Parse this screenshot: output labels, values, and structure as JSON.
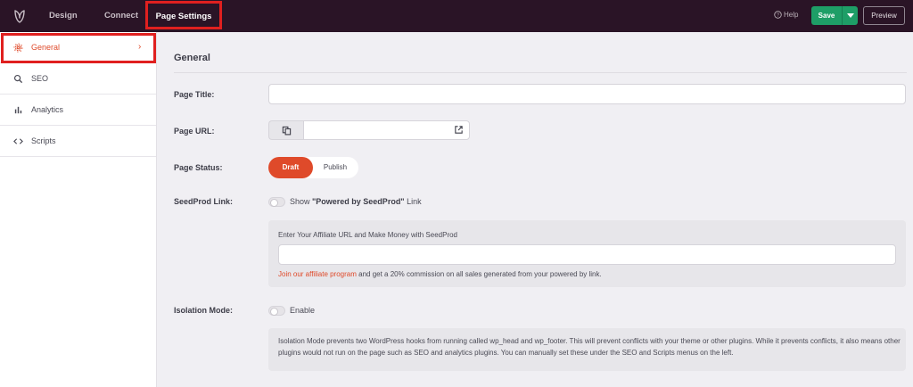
{
  "topbar": {
    "tabs": {
      "design": "Design",
      "connect": "Connect",
      "page_settings": "Page Settings"
    },
    "help": "Help",
    "save": "Save",
    "preview": "Preview"
  },
  "sidebar": {
    "items": [
      {
        "label": "General",
        "icon": "gear-icon"
      },
      {
        "label": "SEO",
        "icon": "search-icon"
      },
      {
        "label": "Analytics",
        "icon": "bar-chart-icon"
      },
      {
        "label": "Scripts",
        "icon": "code-icon"
      }
    ]
  },
  "main": {
    "heading": "General",
    "page_title_label": "Page Title:",
    "page_title_value": "",
    "page_url_label": "Page URL:",
    "page_url_value": "",
    "page_status_label": "Page Status:",
    "status_draft": "Draft",
    "status_publish": "Publish",
    "seedprod_link_label": "SeedProd Link:",
    "seedprod_show": "Show ",
    "seedprod_powered": "\"Powered by SeedProd\"",
    "seedprod_link_word": " Link",
    "affiliate_title": "Enter Your Affiliate URL and Make Money with SeedProd",
    "affiliate_value": "",
    "affiliate_link": "Join our affiliate program",
    "affiliate_note": " and get a 20% commission on all sales generated from your powered by link.",
    "isolation_label": "Isolation Mode:",
    "isolation_enable": "Enable",
    "isolation_text": "Isolation Mode prevents two WordPress hooks from running called wp_head and wp_footer. This will prevent conflicts with your theme or other plugins. While it prevents conflicts, it also means other plugins would not run on the page such as SEO and analytics plugins. You can manually set these under the SEO and Scripts menus on the left."
  },
  "colors": {
    "topbar_bg": "#2a1426",
    "accent": "#df4a2a",
    "save_green": "#1e9e67",
    "highlight_red": "#e0201f"
  }
}
